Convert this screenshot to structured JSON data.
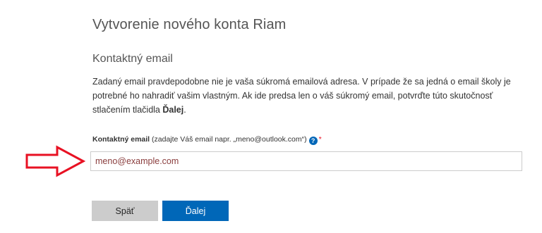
{
  "page": {
    "title": "Vytvorenie nového konta Riam",
    "section_title": "Kontaktný email"
  },
  "info": {
    "text": "Zadaný email pravdepodobne nie je vaša súkromá emailová adresa. V prípade že sa jedná o email školy je potrebné ho nahradiť vašim vlastným. Ak ide predsa len o váš súkromý email, potvrďte túto skutočnosť stlačením tlačidla ",
    "emphasis": "Ďalej",
    "end": "."
  },
  "field": {
    "label": "Kontaktný email",
    "hint": " (zadajte Váš email napr. „meno@outlook.com“)",
    "help_icon_glyph": "?",
    "required_mark": "*",
    "value": "",
    "placeholder": "meno@example.com"
  },
  "buttons": {
    "back_label": "Späť",
    "next_label": "Ďalej"
  },
  "colors": {
    "accent": "#0067b8",
    "required": "#e81123",
    "arrow": "#e81123"
  },
  "icons": {
    "help": "question-circle-icon",
    "pointer": "arrow-right-outline-icon"
  }
}
